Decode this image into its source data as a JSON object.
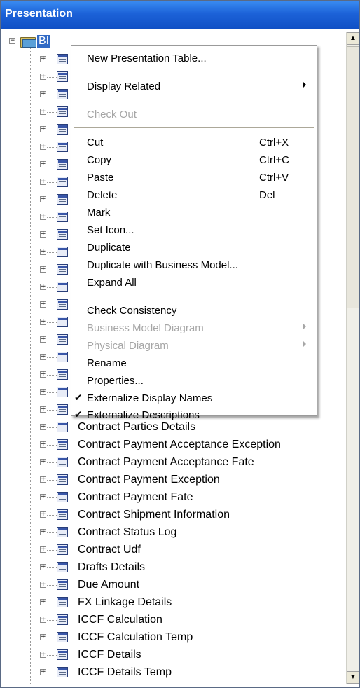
{
  "window": {
    "title": "Presentation"
  },
  "tree": {
    "root_label": "BI",
    "items": [
      "Contract Parties Details",
      "Contract Payment Acceptance Exception",
      "Contract Payment Acceptance Fate",
      "Contract Payment Exception",
      "Contract Payment Fate",
      "Contract Shipment Information",
      "Contract Status Log",
      "Contract Udf",
      "Drafts Details",
      "Due Amount",
      "FX Linkage Details",
      "ICCF Calculation",
      "ICCF Calculation Temp",
      "ICCF Details",
      "ICCF Details Temp"
    ]
  },
  "context_menu": {
    "new_presentation_table": "New Presentation Table...",
    "display_related": "Display Related",
    "check_out": "Check Out",
    "cut": "Cut",
    "cut_shortcut": "Ctrl+X",
    "copy": "Copy",
    "copy_shortcut": "Ctrl+C",
    "paste": "Paste",
    "paste_shortcut": "Ctrl+V",
    "delete": "Delete",
    "delete_shortcut": "Del",
    "mark": "Mark",
    "set_icon": "Set Icon...",
    "duplicate": "Duplicate",
    "duplicate_with_bm": "Duplicate with Business Model...",
    "expand_all": "Expand All",
    "check_consistency": "Check Consistency",
    "business_model_diagram": "Business Model Diagram",
    "physical_diagram": "Physical Diagram",
    "rename": "Rename",
    "properties": "Properties...",
    "externalize_display_names": "Externalize Display Names",
    "externalize_descriptions": "Externalize Descriptions",
    "check_mark": "✔"
  },
  "colors": {
    "title_bar": "#1c62d8",
    "selection": "#316ac5",
    "disabled_text": "#a6a6a6"
  }
}
